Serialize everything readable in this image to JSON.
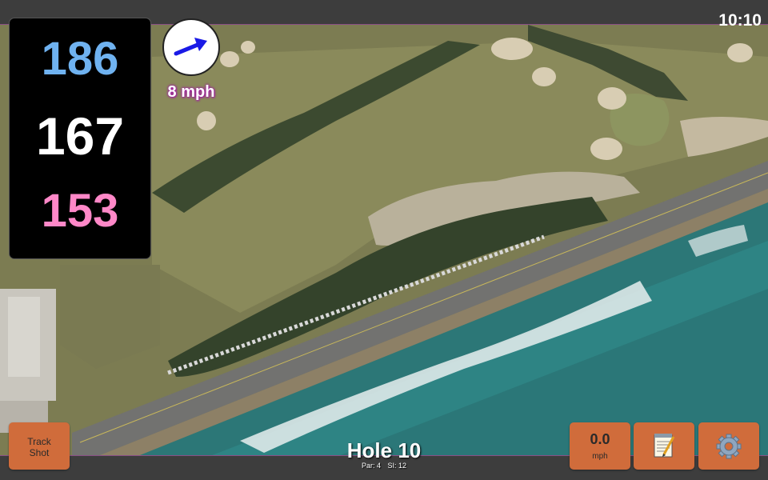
{
  "status_bar": {
    "time": "10:10"
  },
  "yardages": {
    "back": "186",
    "middle": "167",
    "front": "153",
    "colors": {
      "back": "#6fb2f0",
      "middle": "#ffffff",
      "front": "#ff88c8"
    }
  },
  "wind": {
    "speed_label": "8 mph",
    "direction_icon": "arrow-right-up-icon",
    "arrow_color": "#1a1ae6"
  },
  "hole": {
    "title": "Hole 10",
    "par_label": "Par: 4",
    "si_label": "SI: 12"
  },
  "buttons": {
    "track_shot_label": "Track Shot",
    "speed_value": "0.0",
    "speed_unit": "mph",
    "notes_icon": "notepad-icon",
    "settings_icon": "gear-icon",
    "accent": "#d06c3b"
  }
}
